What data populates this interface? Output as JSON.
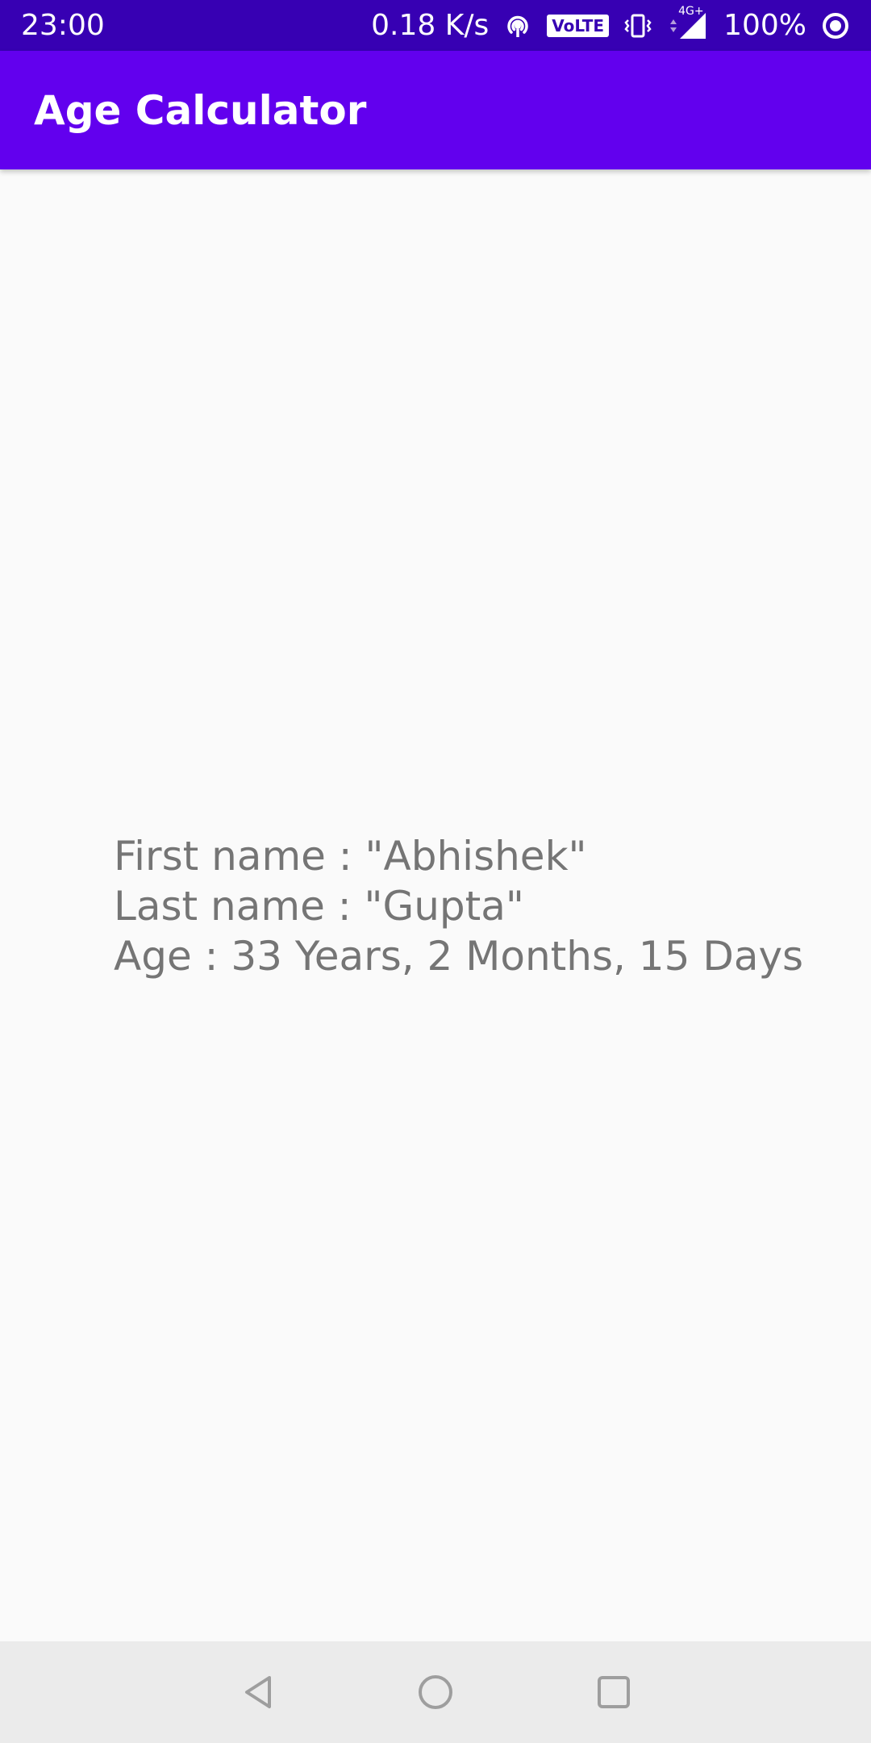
{
  "status_bar": {
    "time": "23:00",
    "network_speed": "0.18 K/s",
    "volte_label": "VoLTE",
    "network_type": "4G+",
    "battery_percent": "100%",
    "icons": [
      "hotspot-icon",
      "volte-icon",
      "vibrate-icon",
      "signal-icon",
      "battery-icon"
    ]
  },
  "app_bar": {
    "title": "Age Calculator"
  },
  "result": {
    "first_name_line": "First name : \"Abhishek\"",
    "last_name_line": "Last name : \"Gupta\"",
    "age_line": "Age : 33 Years, 2 Months, 15 Days"
  },
  "nav_bar": {
    "buttons": [
      "back-icon",
      "home-icon",
      "recents-icon"
    ]
  },
  "colors": {
    "status_bar": "#3700b3",
    "app_bar": "#6200ee",
    "background": "#fafafa",
    "text": "#757575",
    "nav_bar": "#ebebeb",
    "nav_icon": "#9e9e9e"
  }
}
